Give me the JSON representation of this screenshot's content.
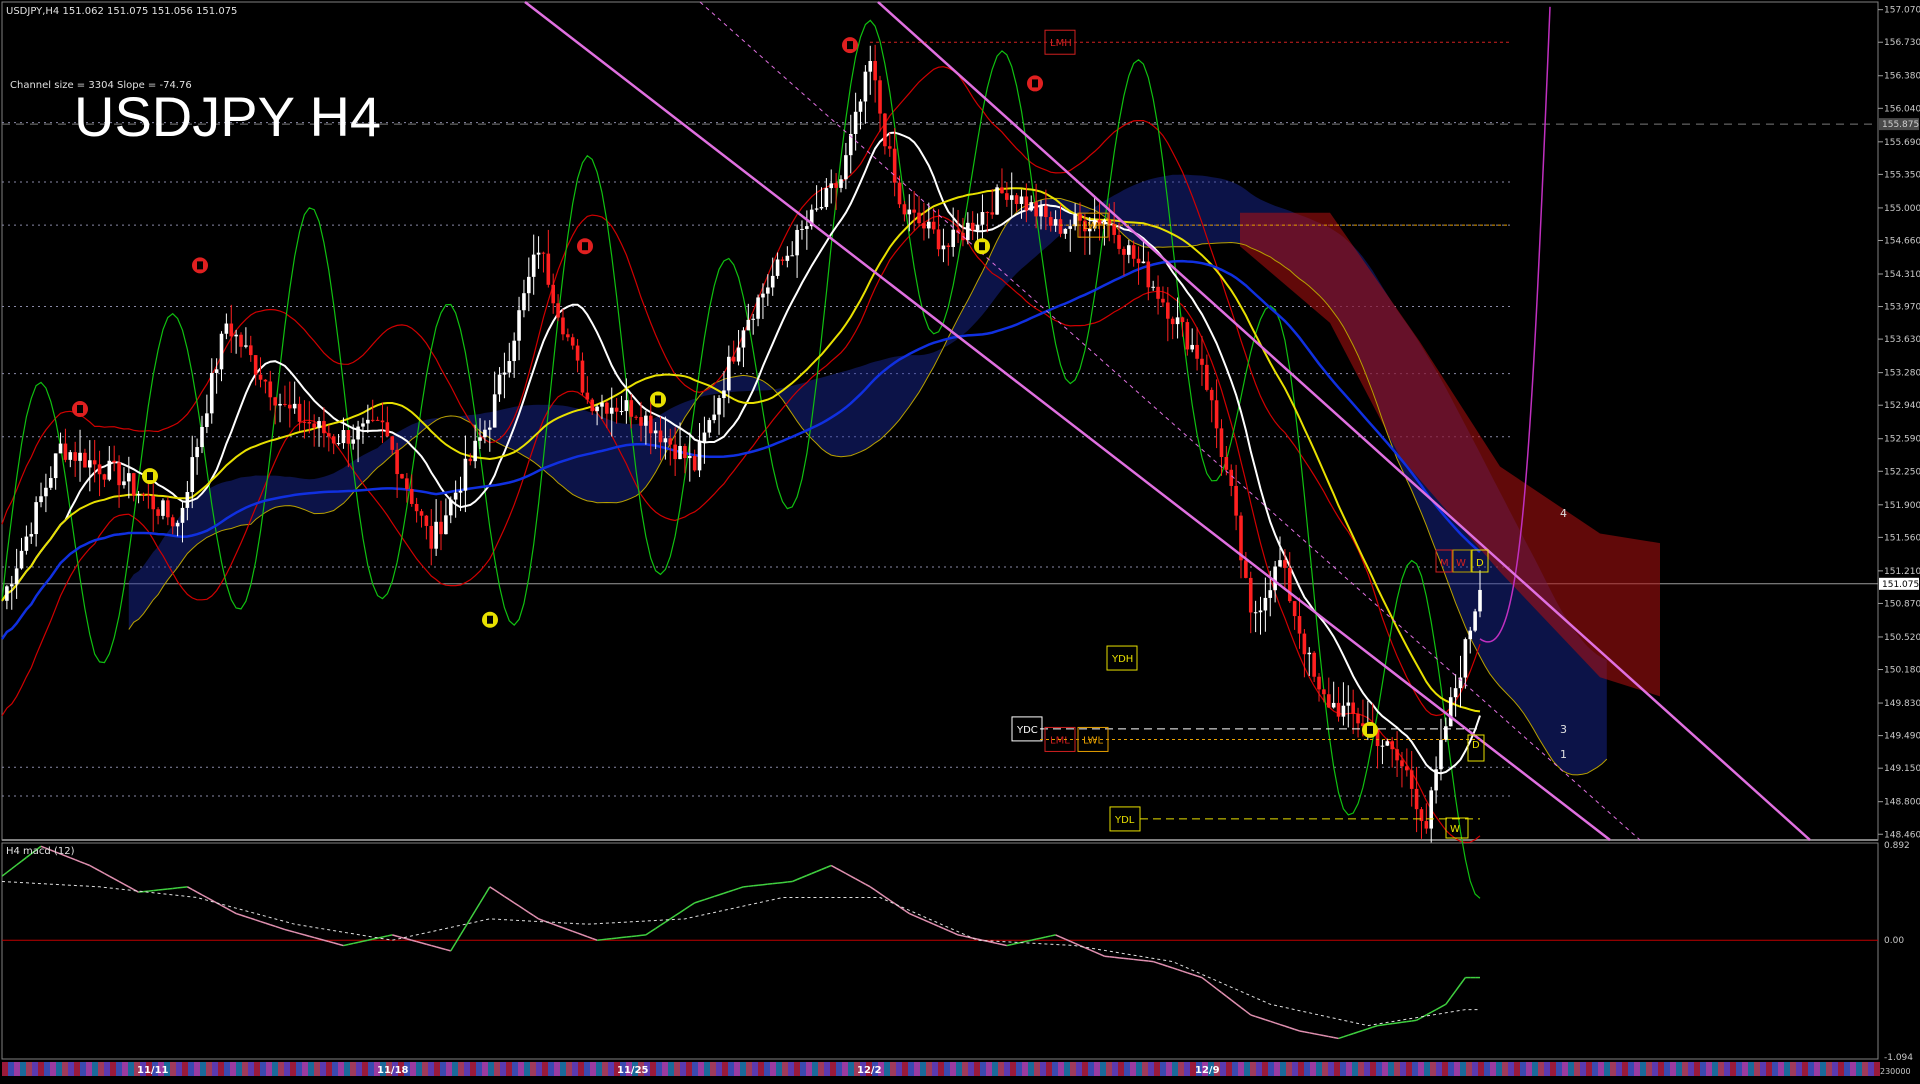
{
  "header": {
    "symbol_line": "USDJPY,H4  151.062 151.075 151.056 151.075",
    "channel_info": "Channel size = 3304 Slope = -74.76",
    "big_title": "USDJPY H4"
  },
  "colors": {
    "background": "#000000",
    "bull_candle": "#ffffff",
    "bear_candle": "#ff2020",
    "ma_white": "#ffffff",
    "ma_yellow": "#e8e000",
    "ma_blue": "#1030e0",
    "band_green": "#10c010",
    "band_red": "#d00000",
    "ichimoku_blue": "#1a2aa0",
    "ichimoku_red": "#b01010",
    "ichimoku_edge": "#b8a000",
    "channel": "#e070e0",
    "macd_up": "#40d040",
    "macd_down": "#e090b0",
    "axis_text": "#c8c8c8",
    "grid": "#5a5a5a"
  },
  "chart_data": [
    {
      "type": "candlestick",
      "title": "USDJPY H4",
      "price_axis": {
        "ticks": [
          "157.070",
          "156.730",
          "156.380",
          "156.040",
          "155.690",
          "155.350",
          "155.000",
          "154.660",
          "154.310",
          "153.970",
          "153.630",
          "153.280",
          "152.940",
          "152.590",
          "152.250",
          "151.900",
          "151.560",
          "151.210",
          "150.870",
          "150.520",
          "150.180",
          "149.830",
          "149.490",
          "149.150",
          "148.800",
          "148.460"
        ],
        "ylim": [
          148.4,
          157.15
        ],
        "current_price": "151.075",
        "marker_price": "155.875"
      },
      "date_axis": {
        "labels": [
          "11/11",
          "11/18",
          "11/25",
          "12/2",
          "12/9"
        ]
      },
      "levels": [
        {
          "label": "LMH",
          "price": 156.73
        },
        {
          "label": "LWH",
          "price": 154.82
        },
        {
          "label": "YDH",
          "price": 150.3
        },
        {
          "label": "YDC",
          "price": 149.56
        },
        {
          "label": "LML",
          "price": 149.45
        },
        {
          "label": "LWL",
          "price": 149.45
        },
        {
          "label": "YDL",
          "price": 148.62
        }
      ],
      "box_labels": {
        "m": "M",
        "w": "W",
        "d": "D",
        "d2": "D",
        "w2": "W"
      },
      "projection_labels": [
        "4",
        "3",
        "1"
      ],
      "series": [
        {
          "name": "price",
          "close_path": [
            [
              0,
              150.9
            ],
            [
              12,
              152.5
            ],
            [
              24,
              152.2
            ],
            [
              36,
              151.7
            ],
            [
              46,
              153.8
            ],
            [
              58,
              152.9
            ],
            [
              68,
              152.6
            ],
            [
              78,
              152.7
            ],
            [
              88,
              151.5
            ],
            [
              100,
              152.8
            ],
            [
              110,
              154.6
            ],
            [
              120,
              153.0
            ],
            [
              130,
              152.9
            ],
            [
              142,
              152.3
            ],
            [
              152,
              153.8
            ],
            [
              162,
              154.6
            ],
            [
              172,
              155.3
            ],
            [
              178,
              156.5
            ],
            [
              184,
              155.0
            ],
            [
              194,
              154.6
            ],
            [
              206,
              155.2
            ],
            [
              216,
              154.8
            ],
            [
              226,
              154.9
            ],
            [
              236,
              154.2
            ],
            [
              246,
              153.4
            ],
            [
              252,
              152.0
            ],
            [
              256,
              150.7
            ],
            [
              262,
              151.3
            ],
            [
              270,
              149.9
            ],
            [
              280,
              149.6
            ],
            [
              288,
              149.1
            ],
            [
              292,
              148.55
            ],
            [
              296,
              149.6
            ],
            [
              300,
              150.4
            ],
            [
              303,
              151.075
            ]
          ]
        },
        {
          "name": "white_ma",
          "color_key": "ma_white"
        },
        {
          "name": "yellow_ma",
          "color_key": "ma_yellow"
        },
        {
          "name": "blue_ma",
          "color_key": "ma_blue"
        }
      ]
    },
    {
      "type": "line",
      "title": "H4 macd (12)",
      "ylim": [
        -1.094,
        0.892
      ],
      "ticks": [
        "0.892",
        "0.00",
        "-1.094"
      ],
      "bottom_label": "230000",
      "series": [
        {
          "name": "macd",
          "points": [
            [
              0,
              0.6
            ],
            [
              8,
              0.88
            ],
            [
              18,
              0.7
            ],
            [
              28,
              0.45
            ],
            [
              38,
              0.5
            ],
            [
              48,
              0.25
            ],
            [
              58,
              0.1
            ],
            [
              70,
              -0.05
            ],
            [
              80,
              0.05
            ],
            [
              92,
              -0.1
            ],
            [
              100,
              0.5
            ],
            [
              110,
              0.2
            ],
            [
              122,
              0.0
            ],
            [
              132,
              0.05
            ],
            [
              142,
              0.35
            ],
            [
              152,
              0.5
            ],
            [
              162,
              0.55
            ],
            [
              170,
              0.7
            ],
            [
              178,
              0.5
            ],
            [
              186,
              0.25
            ],
            [
              196,
              0.05
            ],
            [
              206,
              -0.05
            ],
            [
              216,
              0.05
            ],
            [
              226,
              -0.15
            ],
            [
              236,
              -0.2
            ],
            [
              246,
              -0.35
            ],
            [
              256,
              -0.7
            ],
            [
              266,
              -0.85
            ],
            [
              274,
              -0.92
            ],
            [
              282,
              -0.8
            ],
            [
              290,
              -0.75
            ],
            [
              296,
              -0.6
            ],
            [
              300,
              -0.35
            ]
          ]
        },
        {
          "name": "signal",
          "points": [
            [
              0,
              0.55
            ],
            [
              20,
              0.5
            ],
            [
              40,
              0.4
            ],
            [
              60,
              0.15
            ],
            [
              80,
              0.0
            ],
            [
              100,
              0.2
            ],
            [
              120,
              0.15
            ],
            [
              140,
              0.2
            ],
            [
              160,
              0.4
            ],
            [
              180,
              0.4
            ],
            [
              200,
              0.0
            ],
            [
              220,
              -0.05
            ],
            [
              240,
              -0.2
            ],
            [
              260,
              -0.6
            ],
            [
              280,
              -0.8
            ],
            [
              300,
              -0.65
            ]
          ]
        }
      ]
    }
  ]
}
